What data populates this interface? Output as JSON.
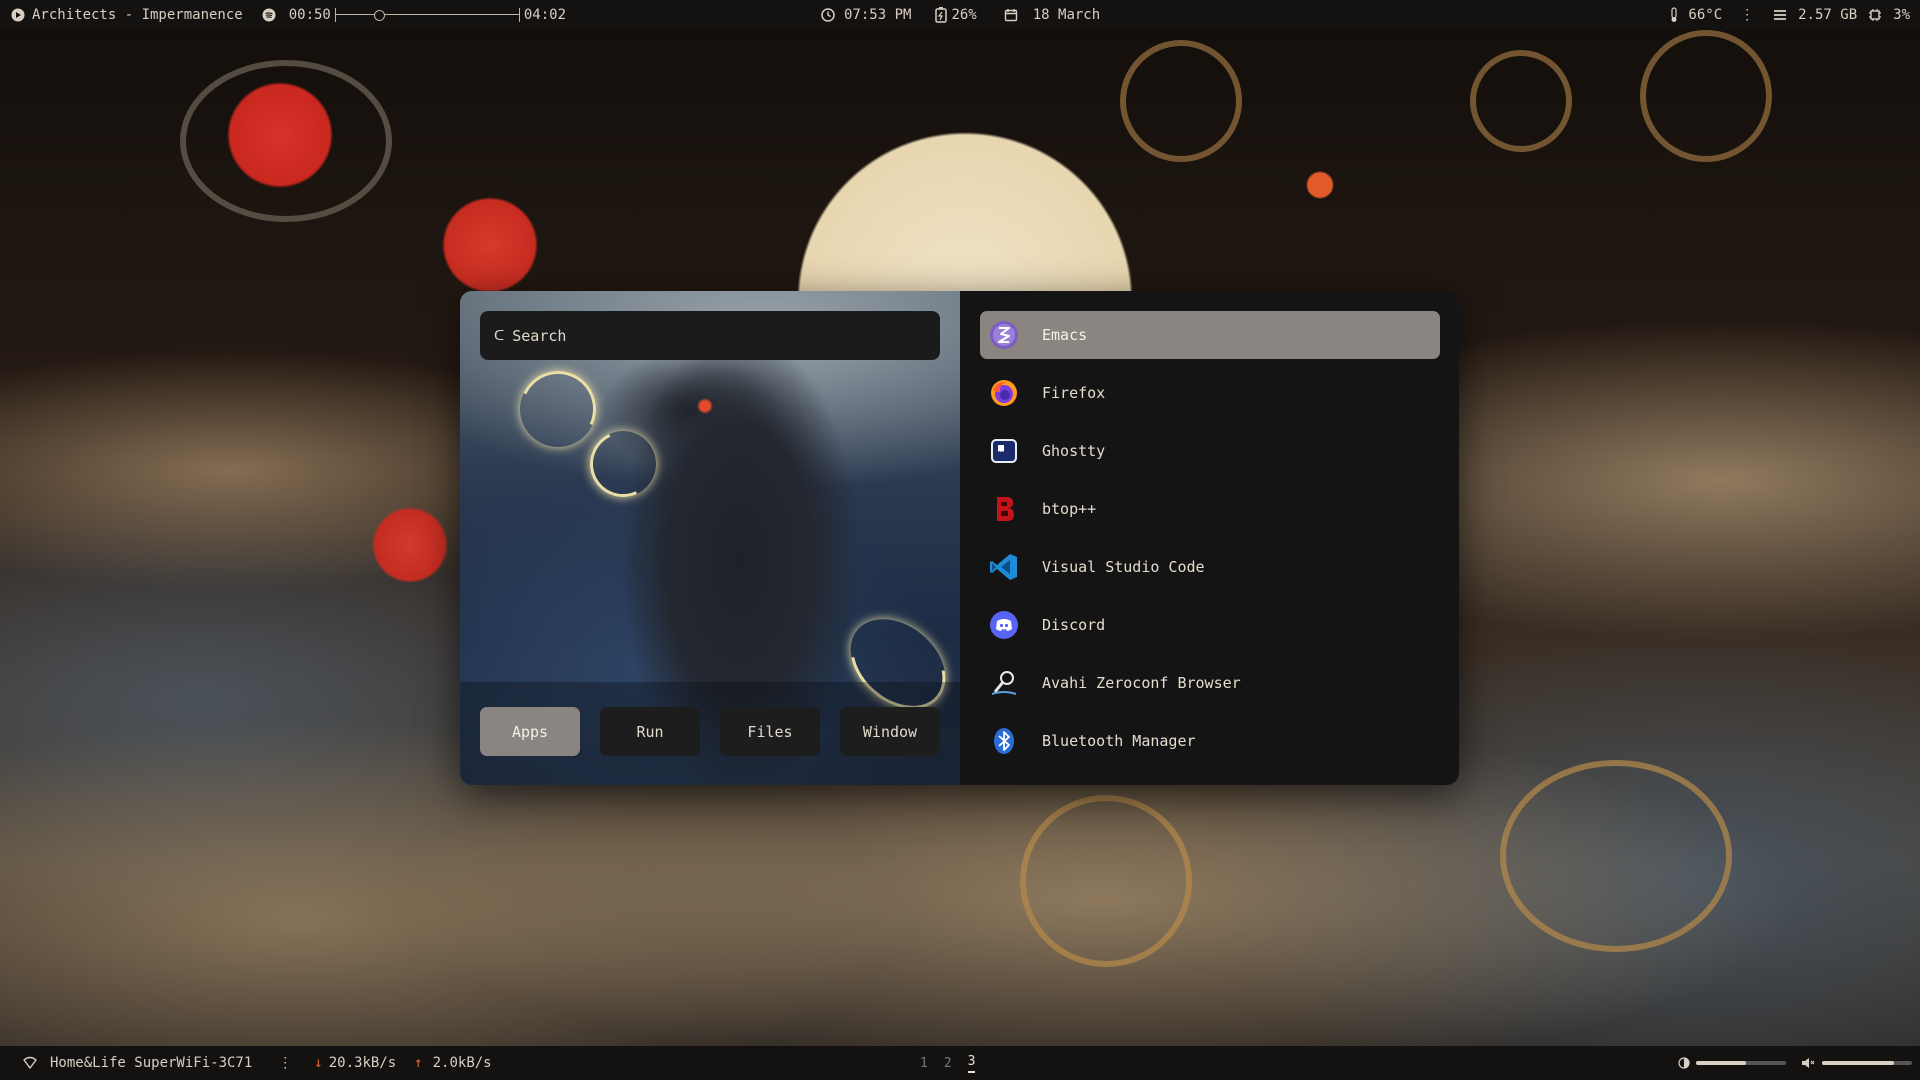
{
  "topbar": {
    "media": {
      "title": "Architects - Impermanence",
      "elapsed": "00:50",
      "total": "04:02",
      "progress_fraction": 0.21
    },
    "clock": "07:53 PM",
    "battery": "26%",
    "date": "18 March",
    "temperature": "66°C",
    "memory": "2.57 GB",
    "cpu": "3%"
  },
  "launcher": {
    "search_placeholder": "Search",
    "modes": [
      {
        "label": "Apps",
        "active": true
      },
      {
        "label": "Run",
        "active": false
      },
      {
        "label": "Files",
        "active": false
      },
      {
        "label": "Window",
        "active": false
      }
    ],
    "apps": [
      {
        "label": "Emacs",
        "icon": "emacs-icon",
        "selected": true
      },
      {
        "label": "Firefox",
        "icon": "firefox-icon"
      },
      {
        "label": "Ghostty",
        "icon": "ghostty-icon"
      },
      {
        "label": "btop++",
        "icon": "btop-icon"
      },
      {
        "label": "Visual Studio Code",
        "icon": "vscode-icon"
      },
      {
        "label": "Discord",
        "icon": "discord-icon"
      },
      {
        "label": "Avahi Zeroconf Browser",
        "icon": "avahi-icon"
      },
      {
        "label": "Bluetooth Manager",
        "icon": "bluetooth-icon"
      }
    ]
  },
  "bottombar": {
    "wifi_name": "Home&Life SuperWiFi-3C71",
    "download": "20.3kB/s",
    "upload": "2.0kB/s",
    "workspaces": [
      "1",
      "2",
      "3"
    ],
    "active_workspace": "3",
    "brightness_fraction": 0.55,
    "volume_fraction": 0.8
  },
  "colors": {
    "bar_bg": "#141211",
    "selection": "#8a8580",
    "panel_bg": "#141414",
    "accent_red": "#d9322a"
  }
}
